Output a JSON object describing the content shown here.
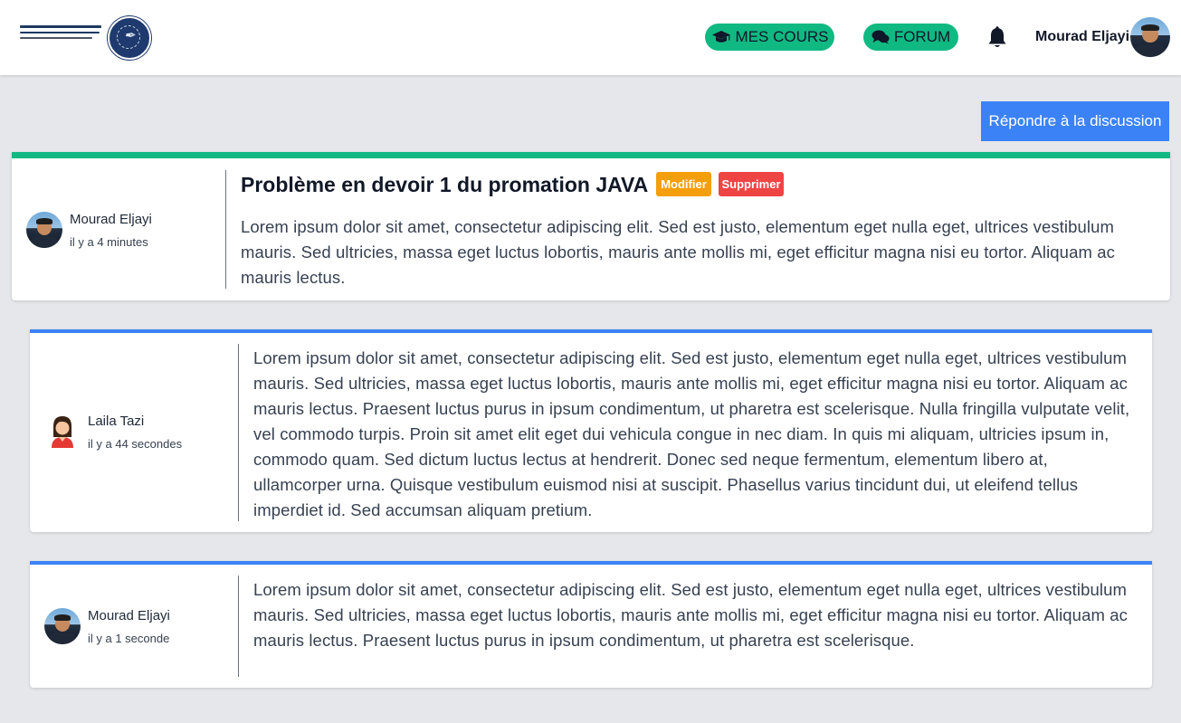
{
  "header": {
    "nav": {
      "courses_label": "MES COURS",
      "forum_label": "FORUM"
    },
    "user": {
      "name": "Mourad Eljayi"
    }
  },
  "actions": {
    "reply_label": "Répondre à la discussion"
  },
  "topic": {
    "title": "Problème en devoir 1 du promation JAVA",
    "modify_label": "Modifier",
    "delete_label": "Supprimer",
    "author": "Mourad Eljayi",
    "time": "il y a 4 minutes",
    "body": "Lorem ipsum dolor sit amet, consectetur adipiscing elit. Sed est justo, elementum eget nulla eget, ultrices vestibulum mauris. Sed ultricies, massa eget luctus lobortis, mauris ante mollis mi, eget efficitur magna nisi eu tortor. Aliquam ac mauris lectus."
  },
  "replies": [
    {
      "author": "Laila Tazi",
      "time": "il y a 44 secondes",
      "body": "Lorem ipsum dolor sit amet, consectetur adipiscing elit. Sed est justo, elementum eget nulla eget, ultrices vestibulum mauris. Sed ultricies, massa eget luctus lobortis, mauris ante mollis mi, eget efficitur magna nisi eu tortor. Aliquam ac mauris lectus. Praesent luctus purus in ipsum condimentum, ut pharetra est scelerisque. Nulla fringilla vulputate velit, vel commodo turpis. Proin sit amet elit eget dui vehicula congue in nec diam. In quis mi aliquam, ultricies ipsum in, commodo quam. Sed dictum luctus lectus at hendrerit. Donec sed neque fermentum, elementum libero at, ullamcorper urna. Quisque vestibulum euismod nisi at suscipit. Phasellus varius tincidunt dui, ut eleifend tellus imperdiet id. Sed accumsan aliquam pretium."
    },
    {
      "author": "Mourad Eljayi",
      "time": "il y a 1 seconde",
      "body": "Lorem ipsum dolor sit amet, consectetur adipiscing elit. Sed est justo, elementum eget nulla eget, ultrices vestibulum mauris. Sed ultricies, massa eget luctus lobortis, mauris ante mollis mi, eget efficitur magna nisi eu tortor. Aliquam ac mauris lectus. Praesent luctus purus in ipsum condimentum, ut pharetra est scelerisque."
    }
  ],
  "icons": {
    "courses": "graduation-cap-icon",
    "forum": "comments-icon",
    "notifications": "bell-icon"
  },
  "colors": {
    "accent_green": "#10b981",
    "accent_blue": "#3b82f6",
    "modify": "#f59e0b",
    "delete": "#ef4444",
    "background": "#e5e7eb"
  }
}
